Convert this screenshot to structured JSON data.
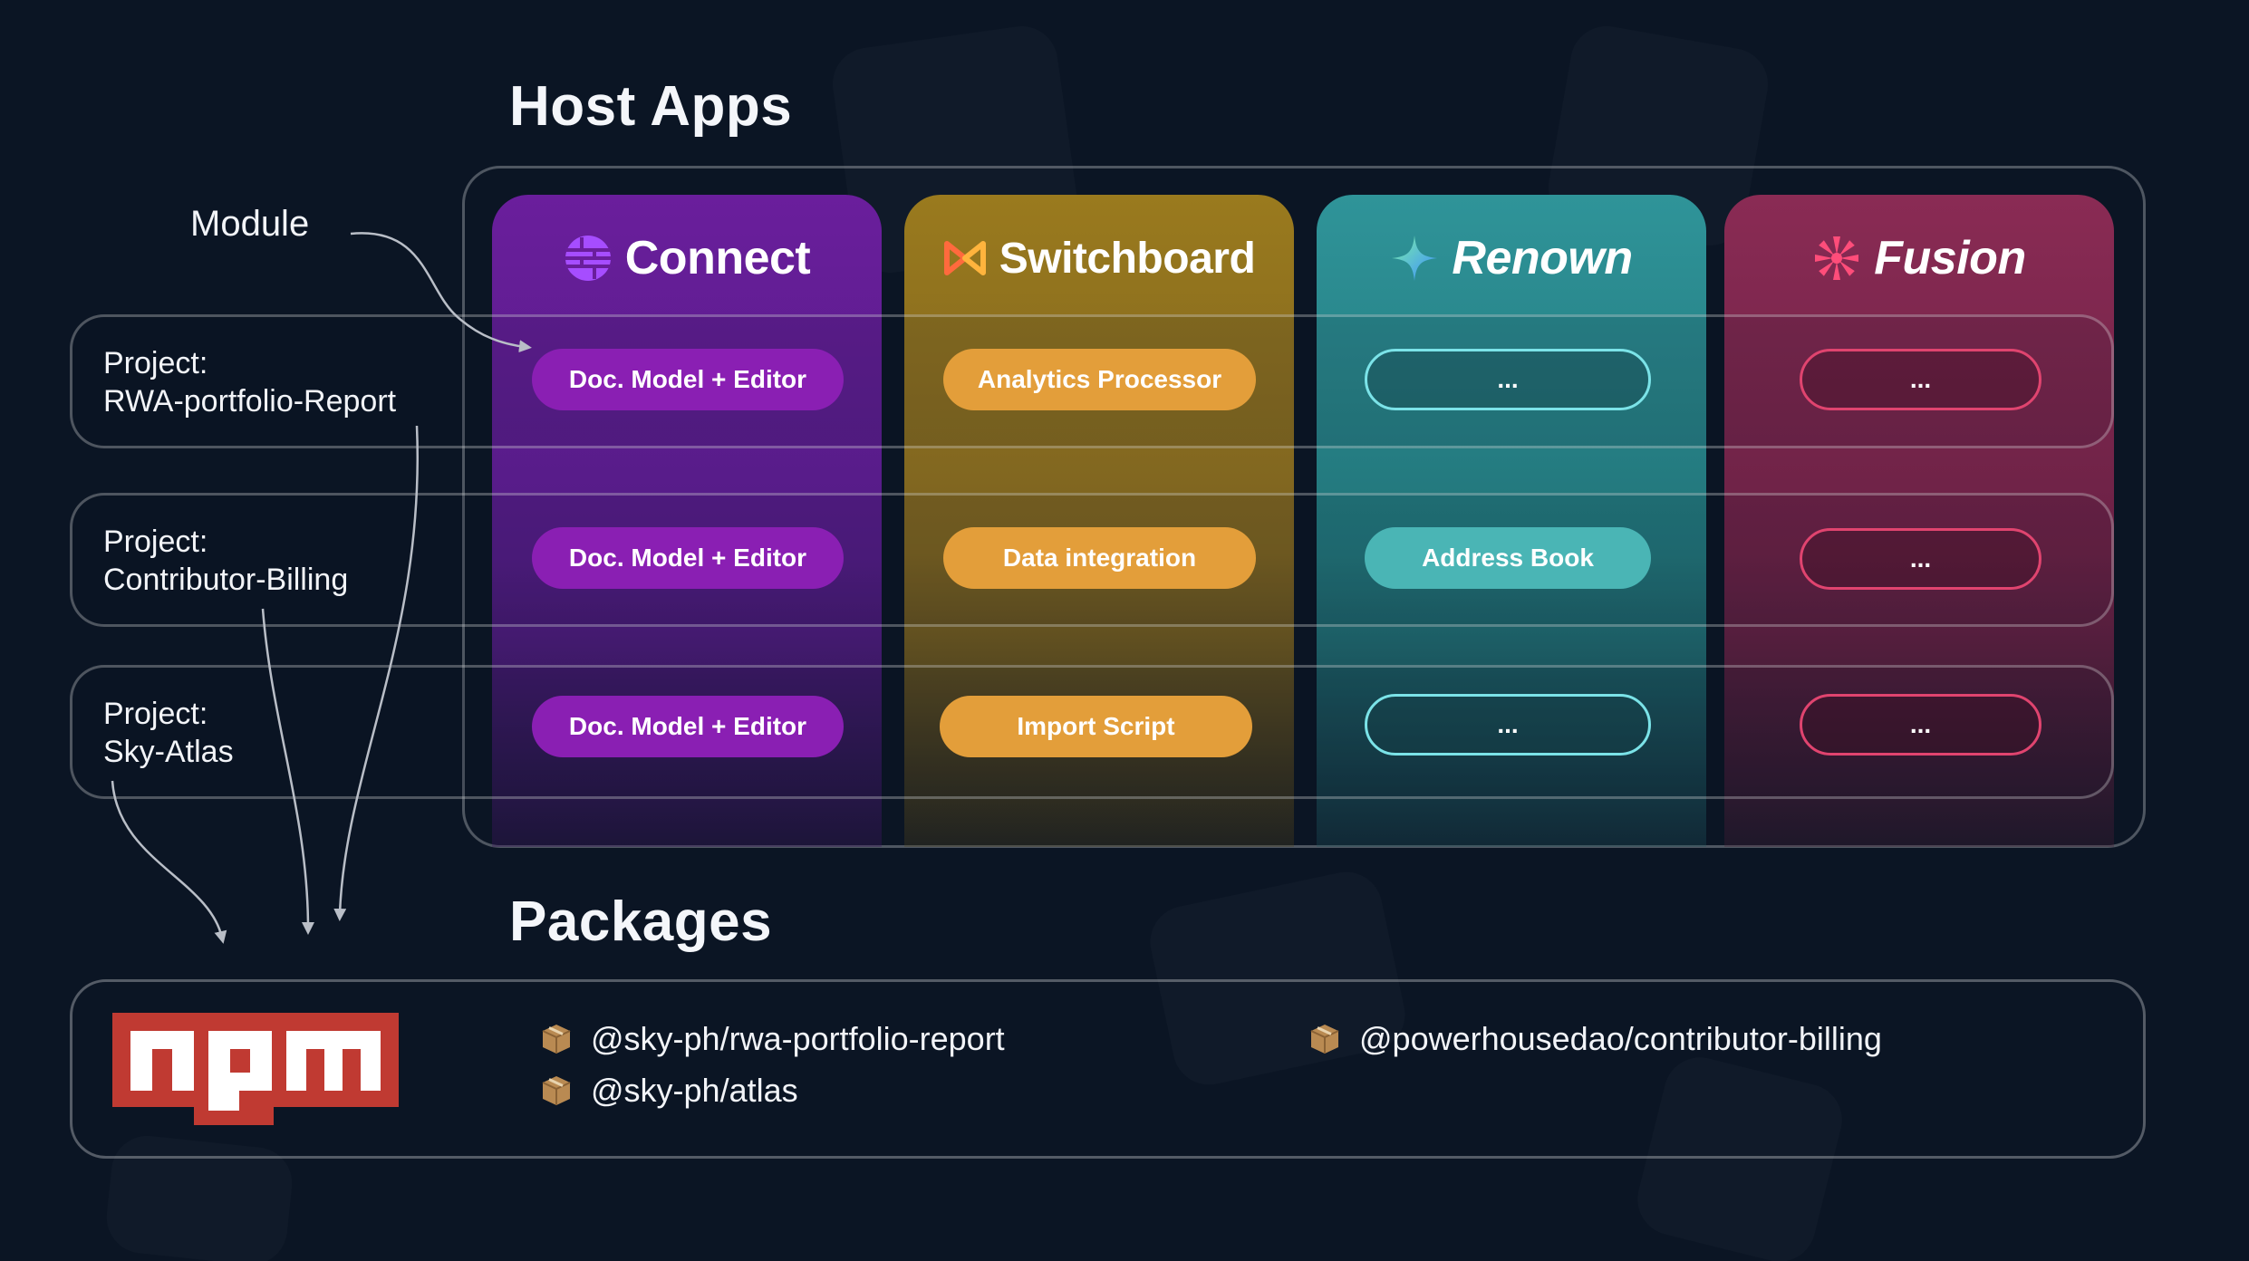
{
  "titles": {
    "host_apps": "Host Apps",
    "packages": "Packages",
    "module": "Module"
  },
  "apps": [
    {
      "name": "Connect",
      "icon": "globe-icon",
      "color": "#8a1fb3"
    },
    {
      "name": "Switchboard",
      "icon": "switchboard-logo-icon",
      "color": "#e39e3a"
    },
    {
      "name": "Renown",
      "icon": "sparkle-icon",
      "color": "#4ab5b5"
    },
    {
      "name": "Fusion",
      "icon": "pinwheel-icon",
      "color": "#e0446f"
    }
  ],
  "projects": [
    {
      "label_line1": "Project:",
      "label_line2": "RWA-portfolio-Report",
      "modules": [
        "Doc. Model + Editor",
        "Analytics Processor",
        "...",
        "..."
      ]
    },
    {
      "label_line1": "Project:",
      "label_line2": "Contributor-Billing",
      "modules": [
        "Doc. Model +  Editor",
        "Data integration",
        "Address Book",
        "..."
      ]
    },
    {
      "label_line1": "Project:",
      "label_line2": "Sky-Atlas",
      "modules": [
        "Doc. Model +  Editor",
        "Import Script",
        "...",
        "..."
      ]
    }
  ],
  "npm": {
    "logo_text": "npm",
    "color": "#c03a32"
  },
  "packages": [
    "@sky-ph/rwa-portfolio-report",
    "@sky-ph/atlas",
    "@powerhousedao/contributor-billing"
  ]
}
